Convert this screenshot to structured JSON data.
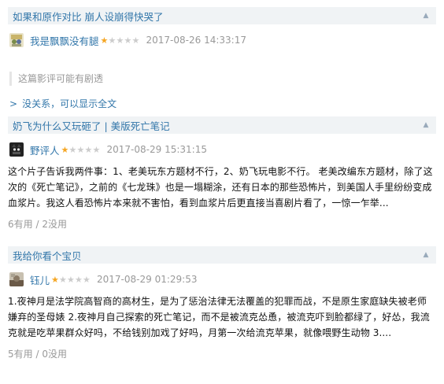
{
  "reviews": [
    {
      "title": "如果和原作对比 崩人设崩得快哭了",
      "user": "我是飘飘没有腿",
      "stars": 1,
      "time": "2017-08-26 14:33:17",
      "spoiler": "这篇影评可能有剧透",
      "show_full": "没关系，可以显示全文"
    },
    {
      "title": "奶飞为什么又玩砸了 | 美版死亡笔记",
      "user": "野评人",
      "stars": 1,
      "time": "2017-08-29 15:31:15",
      "body": "这个片子告诉我两件事：1、老美玩东方题材不行，2、奶飞玩电影不行。 老美改编东方题材，除了这次的《死亡笔记》，之前的《七龙珠》也是一塌糊涂，还有日本的那些恐怖片，到美国人手里纷纷变成血浆片。我这人看恐怖片本来就不害怕，看到血浆片后更直接当喜剧片看了，一惊一乍举...",
      "useful": "6有用",
      "useless": "2没用"
    },
    {
      "title": "我给你看个宝贝",
      "user": "钰儿",
      "stars": 1,
      "time": "2017-08-29 01:29:53",
      "body": "1.夜神月是法学院高智商的高材生，是为了惩治法律无法覆盖的犯罪而战，不是原生家庭缺失被老师嫌弃的圣母婊 2.夜神月自己探索的死亡笔记，而不是被流克怂恿，被流克吓到脸都绿了，好怂，我流克就是吃苹果群众好吗，不给钱别加戏了好吗，月第一次给流克苹果，就像喂野生动物 3....",
      "useful": "5有用",
      "useless": "0没用"
    }
  ],
  "colors": {
    "link": "#3377aa",
    "star_on": "#f5a623",
    "star_off": "#cccccc",
    "muted": "#999999",
    "title_bg": "#f0f3f5"
  },
  "icons": {
    "collapse": "chevron-up-icon",
    "expand": "chevron-right-icon"
  }
}
